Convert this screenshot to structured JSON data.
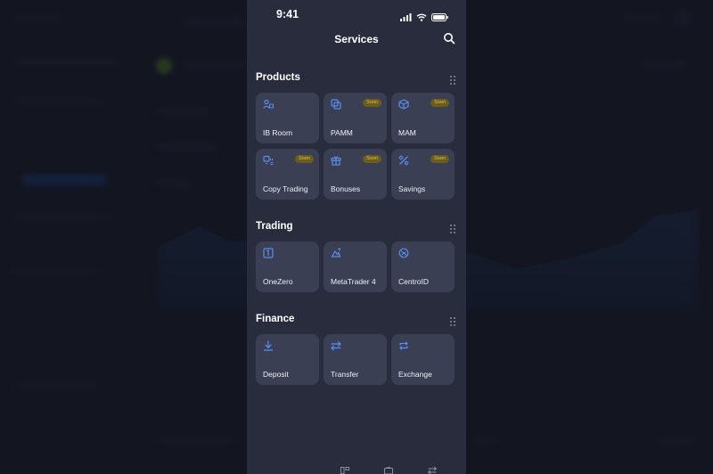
{
  "status": {
    "time": "9:41"
  },
  "header": {
    "title": "Services"
  },
  "sections": [
    {
      "title": "Products",
      "items": [
        {
          "label": "IB Room",
          "icon": "user-network-icon",
          "badge": ""
        },
        {
          "label": "PAMM",
          "icon": "copy-stack-icon",
          "badge": "Soon"
        },
        {
          "label": "MAM",
          "icon": "cube-icon",
          "badge": "Soon"
        },
        {
          "label": "Copy Trading",
          "icon": "copy-trade-icon",
          "badge": "Soon"
        },
        {
          "label": "Bonuses",
          "icon": "gift-icon",
          "badge": "Soon"
        },
        {
          "label": "Savings",
          "icon": "percent-icon",
          "badge": "Soon"
        }
      ]
    },
    {
      "title": "Trading",
      "items": [
        {
          "label": "OneZero",
          "icon": "onezero-icon",
          "badge": ""
        },
        {
          "label": "MetaTrader 4",
          "icon": "metatrader-icon",
          "badge": ""
        },
        {
          "label": "CentroID",
          "icon": "centroid-icon",
          "badge": ""
        }
      ]
    },
    {
      "title": "Finance",
      "items": [
        {
          "label": "Deposit",
          "icon": "download-icon",
          "badge": ""
        },
        {
          "label": "Transfer",
          "icon": "transfer-arrows-icon",
          "badge": ""
        },
        {
          "label": "Exchange",
          "icon": "exchange-cycle-icon",
          "badge": ""
        }
      ]
    }
  ],
  "colors": {
    "accent": "#5b8def",
    "card": "#3a3f53",
    "screen": "#282c3d",
    "badge_bg": "#6b5c1f",
    "badge_text": "#e2c24a"
  }
}
